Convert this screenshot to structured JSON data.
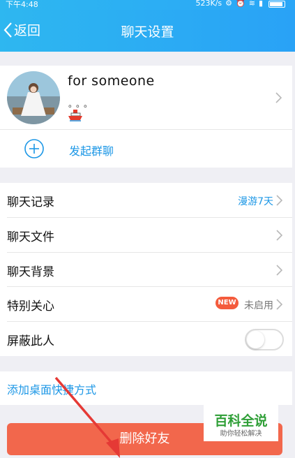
{
  "status_bar": {
    "time": "下午4:48",
    "network_speed": "523K/s"
  },
  "header": {
    "back_label": "返回",
    "title": "聊天设置"
  },
  "profile": {
    "name": "for  someone",
    "status_dots": "。。。"
  },
  "group_chat": {
    "label": "发起群聊"
  },
  "settings": {
    "rows": [
      {
        "label": "聊天记录",
        "value": "漫游7天"
      },
      {
        "label": "聊天文件"
      },
      {
        "label": "聊天背景"
      },
      {
        "label": "特别关心",
        "badge": "NEW",
        "value": "未启用"
      },
      {
        "label": "屏蔽此人",
        "toggle": false
      }
    ]
  },
  "shortcut": {
    "label": "添加桌面快捷方式"
  },
  "delete_button": {
    "label": "删除好友"
  },
  "watermark": {
    "title": "百科全说",
    "subtitle": "助你轻松解决"
  },
  "colors": {
    "header_blue": "#2aa6f7",
    "link_blue": "#1c97e6",
    "delete_red": "#f2674c",
    "badge_red": "#f45b3c",
    "annotation_arrow": "#e53935"
  }
}
